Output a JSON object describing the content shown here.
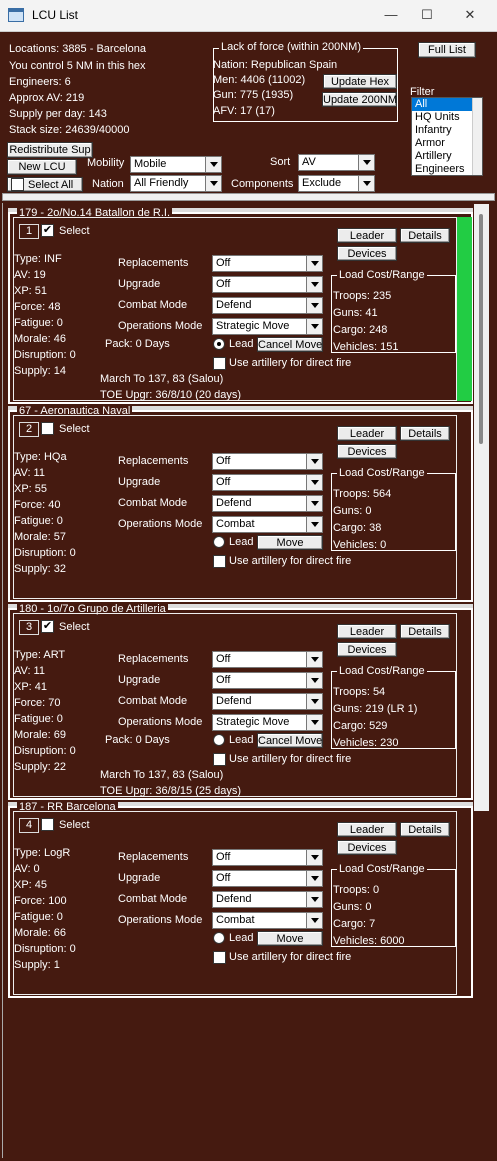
{
  "window": {
    "title": "LCU List",
    "minimize_glyph": "—",
    "maximize_glyph": "☐",
    "close_glyph": "✕"
  },
  "header": {
    "location": "Locations: 3885 - Barcelona",
    "control": "You control 5 NM in this hex",
    "engineers": "Engineers: 6",
    "approx_av": "Approx AV: 219",
    "supply_per_day": "Supply per day: 143",
    "stack_size": "Stack size: 24639/40000",
    "redistribute_label": "Redistribute Sup",
    "new_lcu_label": "New LCU",
    "select_all_label": "Select All",
    "full_list_label": "Full List"
  },
  "lack_of_force": {
    "title": "Lack of force (within 200NM)",
    "nation": "Nation: Republican Spain",
    "men": "Men: 4406 (11002)",
    "gun": "Gun: 775 (1935)",
    "afv": "AFV: 17 (17)",
    "update_hex_label": "Update Hex",
    "update_200_label": "Update 200NM"
  },
  "filters": {
    "mobility_label": "Mobility",
    "mobility_value": "Mobile",
    "nation_label": "Nation",
    "nation_value": "All Friendly",
    "sort_label": "Sort",
    "sort_value": "AV",
    "components_label": "Components",
    "components_value": "Exclude",
    "filter_label": "Filter",
    "filter_options": [
      "All",
      "HQ Units",
      "Infantry",
      "Armor",
      "Artillery",
      "Engineers"
    ],
    "filter_selected": "All"
  },
  "units": [
    {
      "title": "179 - 2o/No.14 Batallon de R.I.",
      "index": "1",
      "select_label": "Select",
      "selected": true,
      "leader_label": "Leader",
      "details_label": "Details",
      "devices_label": "Devices",
      "type": "Type: INF",
      "av": "AV: 19",
      "xp": "XP: 51",
      "force": "Force: 48",
      "fatigue": "Fatigue: 0",
      "morale": "Morale: 46",
      "disruption": "Disruption: 0",
      "supply": "Supply: 14",
      "replacements_label": "Replacements",
      "replacements": "Off",
      "upgrade_label": "Upgrade",
      "upgrade": "Off",
      "combat_mode_label": "Combat Mode",
      "combat_mode": "Defend",
      "operations_mode_label": "Operations Mode",
      "operations_mode": "Strategic Move",
      "pack": "Pack: 0 Days",
      "lead_label": "Lead",
      "lead_checked": true,
      "move_label": "Cancel Move",
      "artillery_label": "Use artillery for direct fire",
      "march_to": "March To 137, 83 (Salou)",
      "toe_upgr": "TOE Upgr: 36/8/10 (20 days)",
      "load_title": "Load Cost/Range",
      "troops": "Troops: 235",
      "guns": "Guns: 41",
      "cargo": "Cargo: 248",
      "vehicles": "Vehicles: 151",
      "status_color": "#22cc44"
    },
    {
      "title": "67 - Aeronautica Naval",
      "index": "2",
      "select_label": "Select",
      "selected": false,
      "leader_label": "Leader",
      "details_label": "Details",
      "devices_label": "Devices",
      "type": "Type: HQa",
      "av": "AV: 11",
      "xp": "XP: 55",
      "force": "Force: 40",
      "fatigue": "Fatigue: 0",
      "morale": "Morale: 57",
      "disruption": "Disruption: 0",
      "supply": "Supply: 32",
      "replacements_label": "Replacements",
      "replacements": "Off",
      "upgrade_label": "Upgrade",
      "upgrade": "Off",
      "combat_mode_label": "Combat Mode",
      "combat_mode": "Defend",
      "operations_mode_label": "Operations Mode",
      "operations_mode": "Combat",
      "pack": "",
      "lead_label": "Lead",
      "lead_checked": false,
      "move_label": "Move",
      "artillery_label": "Use artillery for direct fire",
      "march_to": "",
      "toe_upgr": "",
      "load_title": "Load Cost/Range",
      "troops": "Troops: 564",
      "guns": "Guns: 0",
      "cargo": "Cargo: 38",
      "vehicles": "Vehicles: 0"
    },
    {
      "title": "180 - 1o/7o Grupo de Artilleria",
      "index": "3",
      "select_label": "Select",
      "selected": true,
      "leader_label": "Leader",
      "details_label": "Details",
      "devices_label": "Devices",
      "type": "Type: ART",
      "av": "AV: 11",
      "xp": "XP: 41",
      "force": "Force: 70",
      "fatigue": "Fatigue: 0",
      "morale": "Morale: 69",
      "disruption": "Disruption: 0",
      "supply": "Supply: 22",
      "replacements_label": "Replacements",
      "replacements": "Off",
      "upgrade_label": "Upgrade",
      "upgrade": "Off",
      "combat_mode_label": "Combat Mode",
      "combat_mode": "Defend",
      "operations_mode_label": "Operations Mode",
      "operations_mode": "Strategic Move",
      "pack": "Pack: 0 Days",
      "lead_label": "Lead",
      "lead_checked": false,
      "move_label": "Cancel Move",
      "artillery_label": "Use artillery for direct fire",
      "march_to": "March To 137, 83 (Salou)",
      "toe_upgr": "TOE Upgr: 36/8/15 (25 days)",
      "load_title": "Load Cost/Range",
      "troops": "Troops: 54",
      "guns": "Guns: 219 (LR 1)",
      "cargo": "Cargo: 529",
      "vehicles": "Vehicles: 230"
    },
    {
      "title": "187 - RR Barcelona",
      "index": "4",
      "select_label": "Select",
      "selected": false,
      "leader_label": "Leader",
      "details_label": "Details",
      "devices_label": "Devices",
      "type": "Type: LogR",
      "av": "AV: 0",
      "xp": "XP: 45",
      "force": "Force: 100",
      "fatigue": "Fatigue: 0",
      "morale": "Morale: 66",
      "disruption": "Disruption: 0",
      "supply": "Supply: 1",
      "replacements_label": "Replacements",
      "replacements": "Off",
      "upgrade_label": "Upgrade",
      "upgrade": "Off",
      "combat_mode_label": "Combat Mode",
      "combat_mode": "Defend",
      "operations_mode_label": "Operations Mode",
      "operations_mode": "Combat",
      "pack": "",
      "lead_label": "Lead",
      "lead_checked": false,
      "move_label": "Move",
      "artillery_label": "Use artillery for direct fire",
      "march_to": "",
      "toe_upgr": "",
      "load_title": "Load Cost/Range",
      "troops": "Troops: 0",
      "guns": "Guns: 0",
      "cargo": "Cargo: 7",
      "vehicles": "Vehicles: 6000"
    }
  ]
}
